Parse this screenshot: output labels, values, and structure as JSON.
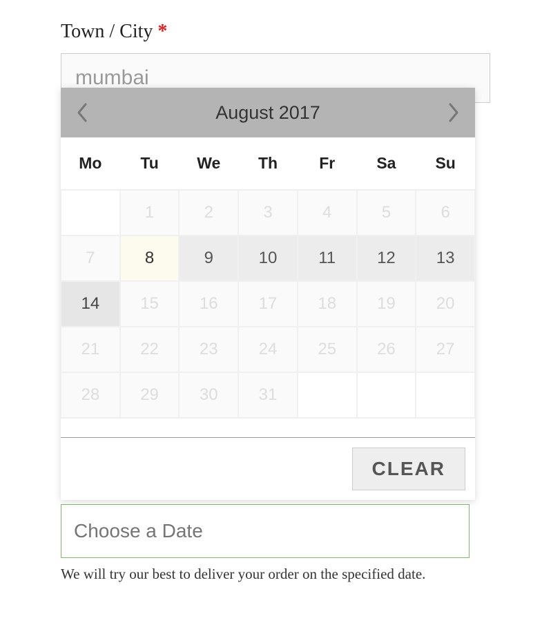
{
  "field": {
    "label": "Town / City",
    "required_mark": "*",
    "value": "mumbai"
  },
  "datepicker": {
    "title": "August 2017",
    "weekdays": [
      "Mo",
      "Tu",
      "We",
      "Th",
      "Fr",
      "Sa",
      "Su"
    ],
    "days": [
      {
        "n": "",
        "cls": "empty"
      },
      {
        "n": "1",
        "cls": "disabled"
      },
      {
        "n": "2",
        "cls": "disabled"
      },
      {
        "n": "3",
        "cls": "disabled"
      },
      {
        "n": "4",
        "cls": "disabled"
      },
      {
        "n": "5",
        "cls": "disabled"
      },
      {
        "n": "6",
        "cls": "disabled"
      },
      {
        "n": "7",
        "cls": "disabled"
      },
      {
        "n": "8",
        "cls": "today"
      },
      {
        "n": "9",
        "cls": "available"
      },
      {
        "n": "10",
        "cls": "available"
      },
      {
        "n": "11",
        "cls": "available"
      },
      {
        "n": "12",
        "cls": "available"
      },
      {
        "n": "13",
        "cls": "available"
      },
      {
        "n": "14",
        "cls": "highlighted"
      },
      {
        "n": "15",
        "cls": "disabled"
      },
      {
        "n": "16",
        "cls": "disabled"
      },
      {
        "n": "17",
        "cls": "disabled"
      },
      {
        "n": "18",
        "cls": "disabled"
      },
      {
        "n": "19",
        "cls": "disabled"
      },
      {
        "n": "20",
        "cls": "disabled"
      },
      {
        "n": "21",
        "cls": "disabled"
      },
      {
        "n": "22",
        "cls": "disabled"
      },
      {
        "n": "23",
        "cls": "disabled"
      },
      {
        "n": "24",
        "cls": "disabled"
      },
      {
        "n": "25",
        "cls": "disabled"
      },
      {
        "n": "26",
        "cls": "disabled"
      },
      {
        "n": "27",
        "cls": "disabled"
      },
      {
        "n": "28",
        "cls": "disabled"
      },
      {
        "n": "29",
        "cls": "disabled"
      },
      {
        "n": "30",
        "cls": "disabled"
      },
      {
        "n": "31",
        "cls": "disabled"
      },
      {
        "n": "",
        "cls": "empty"
      },
      {
        "n": "",
        "cls": "empty"
      },
      {
        "n": "",
        "cls": "empty"
      }
    ],
    "clear_label": "CLEAR"
  },
  "date_field": {
    "placeholder": "Choose a Date"
  },
  "help_text": "We will try our best to deliver your order on the specified date."
}
